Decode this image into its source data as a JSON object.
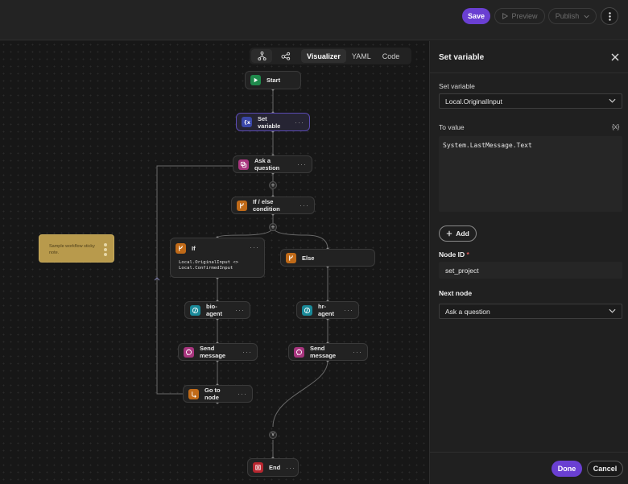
{
  "topbar": {
    "save_label": "Save",
    "preview_label": "Preview",
    "publish_label": "Publish"
  },
  "view_tabs": {
    "tabs": [
      "Visualizer",
      "YAML",
      "Code"
    ],
    "active": "Visualizer"
  },
  "nodes": {
    "start": "Start",
    "set_variable": "Set variable",
    "ask_question": "Ask a question",
    "if_else": "If / else condition",
    "if": "If",
    "if_condition_line1": "Local.OriginalInput <>",
    "if_condition_line2": "Local.ConfirmedInput",
    "else": "Else",
    "bio_agent": "bio-agent",
    "hr_agent": "hr-agent",
    "send_message_left": "Send message",
    "send_message_right": "Send message",
    "go_to_node": "Go to node",
    "end": "End",
    "more_glyph": "···"
  },
  "sticky_note": {
    "line1": "Sample workflow sticky",
    "line2": "note."
  },
  "panel": {
    "title": "Set variable",
    "set_variable_label": "Set variable",
    "set_variable_value": "Local.OriginalInput",
    "to_value_label": "To value",
    "variable_button": "{x}",
    "to_value_text": "System.LastMessage.Text",
    "add_label": "Add",
    "node_id_label": "Node ID",
    "node_id_required": "*",
    "node_id_value": "set_project",
    "next_node_label": "Next node",
    "next_node_value": "Ask a question",
    "done_label": "Done",
    "cancel_label": "Cancel"
  },
  "colors": {
    "accent": "#6a3fd2",
    "start_icon": "#1f8a4c",
    "set_variable_icon": "#3a47a8",
    "ask_question_icon": "#a8357e",
    "condition_icon": "#c06a18",
    "agent_icon": "#1a8a99",
    "send_message_icon": "#a8357e",
    "end_icon": "#b8262f",
    "sticky": "#b89a4c"
  },
  "icons": {
    "more": "vertical-ellipsis-icon",
    "preview": "play-icon",
    "publish_chevron": "chevron-down-icon",
    "close": "close-icon",
    "tree_view": "hierarchy-icon",
    "share": "share-nodes-icon"
  }
}
